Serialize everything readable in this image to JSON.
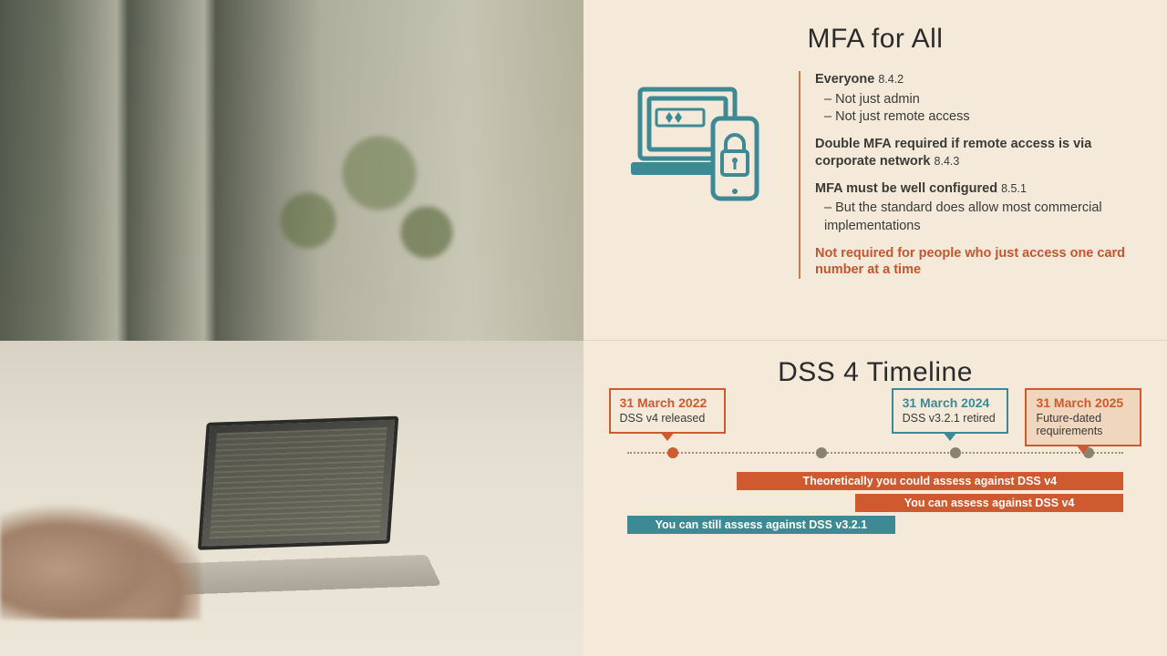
{
  "mfa": {
    "title": "MFA for All",
    "everyone_label": "Everyone",
    "everyone_ref": "8.4.2",
    "everyone_points": [
      "Not just admin",
      "Not just remote access"
    ],
    "double_label": "Double MFA required if remote access is via corporate network",
    "double_ref": "8.4.3",
    "config_label": "MFA must be well configured",
    "config_ref": "8.5.1",
    "config_points": [
      "But the standard does allow most commercial implementations"
    ],
    "note": "Not required for people who just access one card number at a time"
  },
  "timeline": {
    "title": "DSS 4 Timeline",
    "milestones": [
      {
        "date": "31 March 2022",
        "sub": "DSS v4 released",
        "color": "orange",
        "pos": 8
      },
      {
        "date": "",
        "sub": "",
        "color": "grey",
        "pos": 38
      },
      {
        "date": "31 March 2024",
        "sub": "DSS v3.2.1 retired",
        "color": "teal",
        "pos": 65
      },
      {
        "date": "31 March 2025",
        "sub": "Future-dated requirements",
        "color": "orange-fill",
        "pos": 92
      }
    ],
    "bars": [
      {
        "label": "Theoretically you could assess against DSS v4",
        "color": "orange",
        "from": 22,
        "to": 100,
        "row": 0
      },
      {
        "label": "You can assess against DSS v4",
        "color": "orange",
        "from": 46,
        "to": 100,
        "row": 1
      },
      {
        "label": "You can still assess against DSS v3.2.1",
        "color": "teal",
        "from": 0,
        "to": 54,
        "row": 2
      }
    ]
  }
}
